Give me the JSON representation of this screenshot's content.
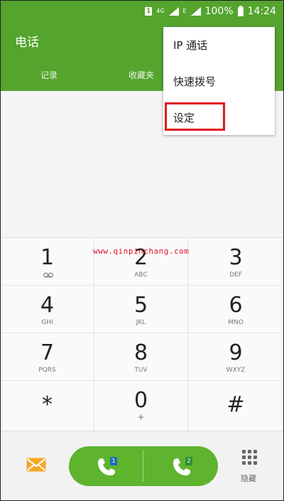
{
  "status": {
    "sim_label": "1",
    "network": "4G",
    "data_label": "E",
    "battery": "100%",
    "time": "14:24"
  },
  "app": {
    "title": "电话"
  },
  "tabs": [
    {
      "label": "记录"
    },
    {
      "label": "收藏夹"
    }
  ],
  "menu": {
    "items": [
      {
        "label": "IP 通话"
      },
      {
        "label": "快速拨号"
      },
      {
        "label": "设定"
      }
    ]
  },
  "watermark": "www.qinpinchang.com",
  "keys": [
    {
      "digit": "1",
      "sub": ""
    },
    {
      "digit": "2",
      "sub": "ABC"
    },
    {
      "digit": "3",
      "sub": "DEF"
    },
    {
      "digit": "4",
      "sub": "GHI"
    },
    {
      "digit": "5",
      "sub": "JKL"
    },
    {
      "digit": "6",
      "sub": "MNO"
    },
    {
      "digit": "7",
      "sub": "PQRS"
    },
    {
      "digit": "8",
      "sub": "TUV"
    },
    {
      "digit": "9",
      "sub": "WXYZ"
    },
    {
      "digit": "*",
      "sub": ""
    },
    {
      "digit": "0",
      "sub": "+"
    },
    {
      "digit": "#",
      "sub": ""
    }
  ],
  "bottom": {
    "sim1": "1",
    "sim2": "2",
    "hide_label": "隐藏"
  },
  "colors": {
    "accent": "#54a42e",
    "call_green": "#5fb42e",
    "highlight": "#e1141c",
    "message_icon": "#f5a623"
  }
}
